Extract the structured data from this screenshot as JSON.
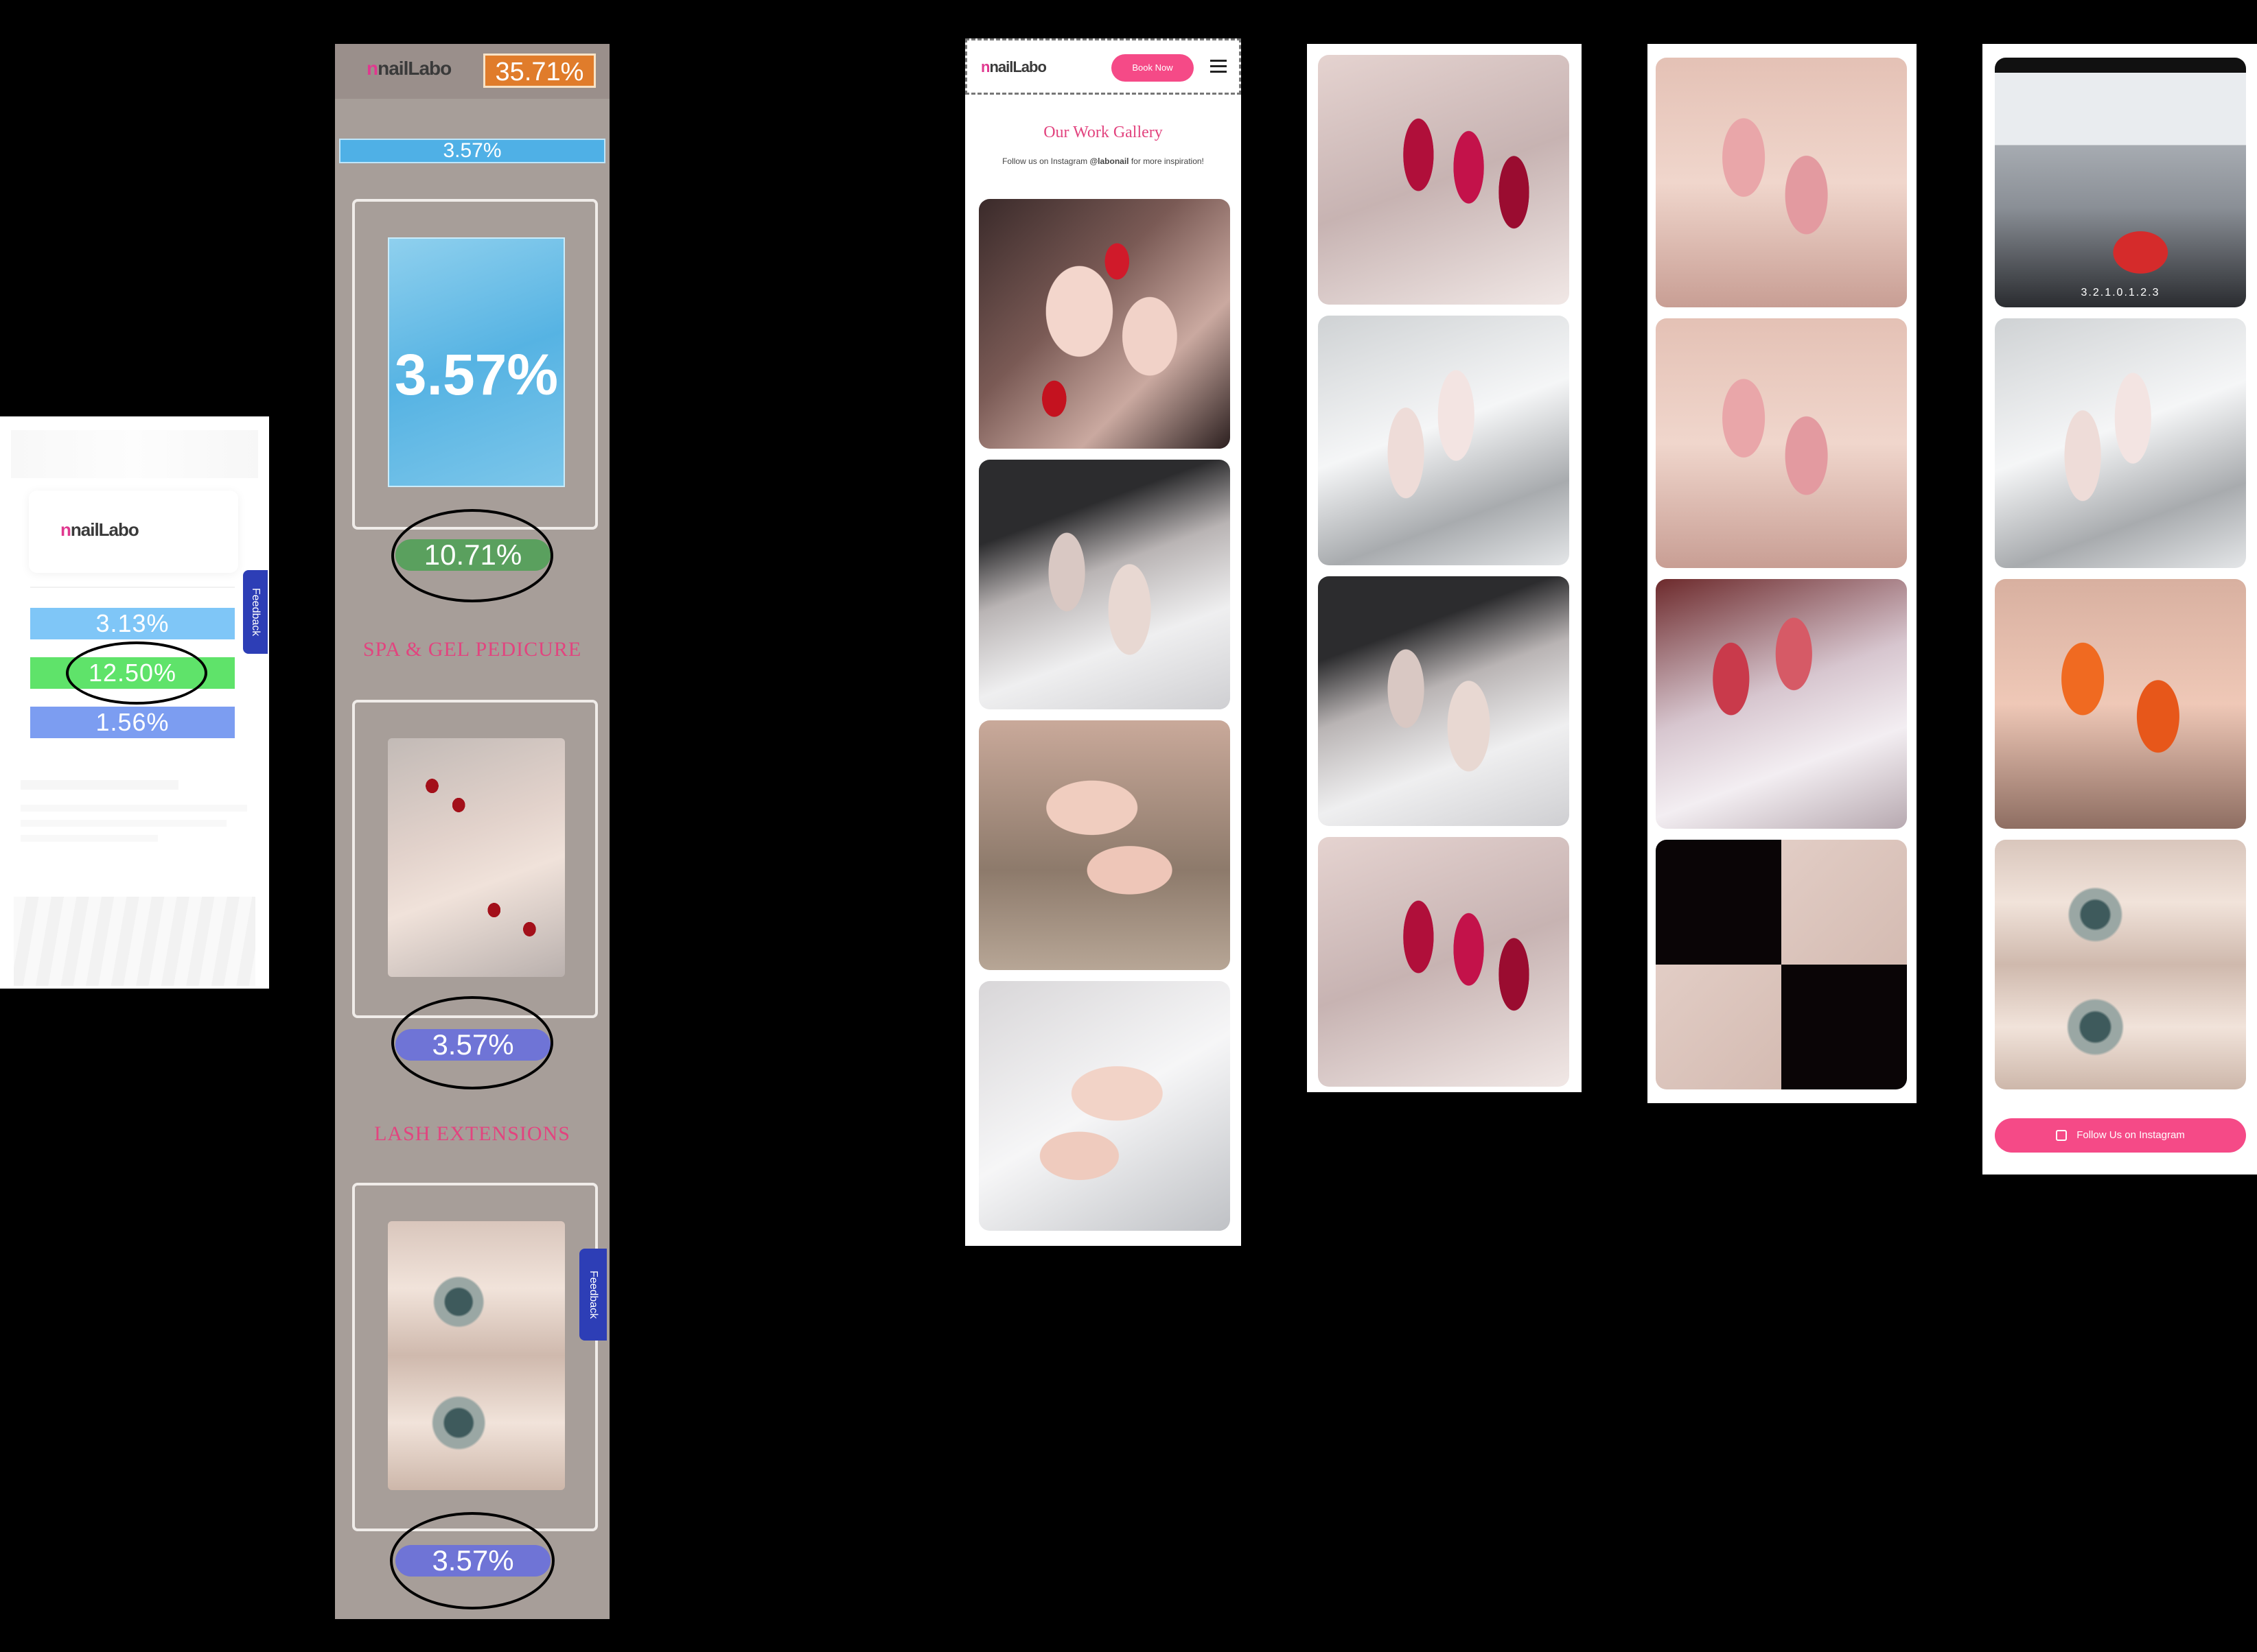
{
  "brand": {
    "logo_text": "nailLabo"
  },
  "panel1": {
    "bars": [
      {
        "label": "3.13%",
        "color": "#7fc6f7"
      },
      {
        "label": "12.50%",
        "color": "#5fe36a"
      },
      {
        "label": "1.56%",
        "color": "#7c9df1"
      }
    ],
    "feedback_label": "Feedback"
  },
  "panel2": {
    "top_badge": "35.71%",
    "section_bar": "3.57%",
    "card1_overlay": "3.57%",
    "button1": "10.71%",
    "section2_title": "SPA & GEL PEDICURE",
    "button2": "3.57%",
    "section3_title": "LASH EXTENSIONS",
    "button3": "3.57%",
    "feedback_label": "Feedback"
  },
  "panel3": {
    "book_now": "Book Now",
    "gallery_title": "Our Work Gallery",
    "subtitle_prefix": "Follow us on Instagram ",
    "subtitle_handle": "@labonail",
    "subtitle_suffix": " for more inspiration!"
  },
  "panel6": {
    "counter": "3.2.1.0.1.2.3",
    "follow_button": "Follow Us on Instagram"
  },
  "colors": {
    "accent_pink": "#f54a87",
    "title_pink": "#e2447f",
    "feedback_blue": "#2d3eb6"
  }
}
